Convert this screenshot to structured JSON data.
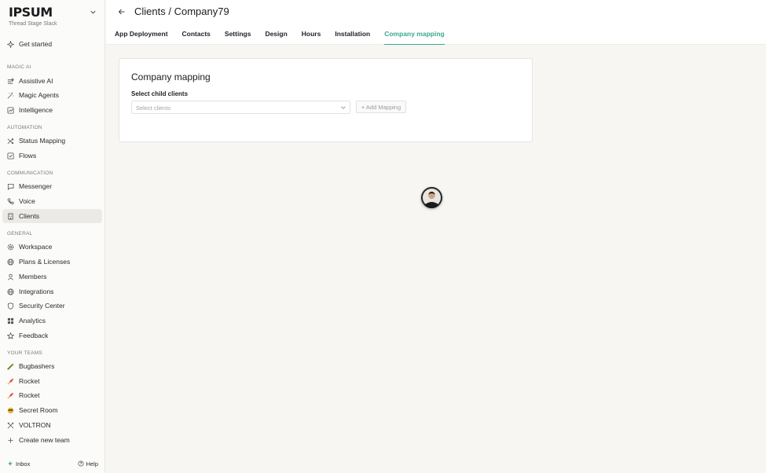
{
  "brand": {
    "logo": "IPSUM",
    "subtitle": "Thread Stage Slack"
  },
  "sidebar": {
    "top_item": {
      "label": "Get started",
      "icon": "sparkle-icon"
    },
    "sections": [
      {
        "title": "MAGIC AI",
        "items": [
          {
            "label": "Assistive AI",
            "icon": "list-sparkle-icon"
          },
          {
            "label": "Magic Agents",
            "icon": "wand-icon"
          },
          {
            "label": "Intelligence",
            "icon": "chart-icon"
          }
        ]
      },
      {
        "title": "AUTOMATION",
        "items": [
          {
            "label": "Status Mapping",
            "icon": "shuffle-icon"
          },
          {
            "label": "Flows",
            "icon": "check-square-icon"
          }
        ]
      },
      {
        "title": "COMMUNICATION",
        "items": [
          {
            "label": "Messenger",
            "icon": "chat-icon"
          },
          {
            "label": "Voice",
            "icon": "phone-icon"
          },
          {
            "label": "Clients",
            "icon": "building-icon",
            "active": true
          }
        ]
      },
      {
        "title": "GENERAL",
        "items": [
          {
            "label": "Workspace",
            "icon": "gear-icon"
          },
          {
            "label": "Plans & Licenses",
            "icon": "globe-icon"
          },
          {
            "label": "Members",
            "icon": "user-icon"
          },
          {
            "label": "Integrations",
            "icon": "globe-icon"
          },
          {
            "label": "Security Center",
            "icon": "shield-icon"
          },
          {
            "label": "Analytics",
            "icon": "grid-icon"
          },
          {
            "label": "Feedback",
            "icon": "star-icon"
          }
        ]
      },
      {
        "title": "YOUR TEAMS",
        "items": [
          {
            "label": "Bugbashers",
            "icon": "bug-emoji-icon"
          },
          {
            "label": "Rocket",
            "icon": "rocket-emoji-icon"
          },
          {
            "label": "Rocket",
            "icon": "rocket-emoji-icon"
          },
          {
            "label": "Secret Room",
            "icon": "face-emoji-icon"
          },
          {
            "label": "VOLTRON",
            "icon": "swords-icon"
          },
          {
            "label": "Create new team",
            "icon": "plus-icon"
          }
        ]
      }
    ],
    "footer": {
      "inbox": "Inbox",
      "help": "Help"
    }
  },
  "header": {
    "title": "Clients / Company79",
    "tabs": [
      {
        "label": "App Deployment"
      },
      {
        "label": "Contacts"
      },
      {
        "label": "Settings"
      },
      {
        "label": "Design"
      },
      {
        "label": "Hours"
      },
      {
        "label": "Installation"
      },
      {
        "label": "Company mapping",
        "active": true
      }
    ]
  },
  "card": {
    "title": "Company mapping",
    "field_label": "Select child clients",
    "select_placeholder": "Select clients",
    "add_button": "+ Add Mapping"
  },
  "colors": {
    "accent": "#3aa88d",
    "active_nav_bg": "#ebeae7"
  }
}
